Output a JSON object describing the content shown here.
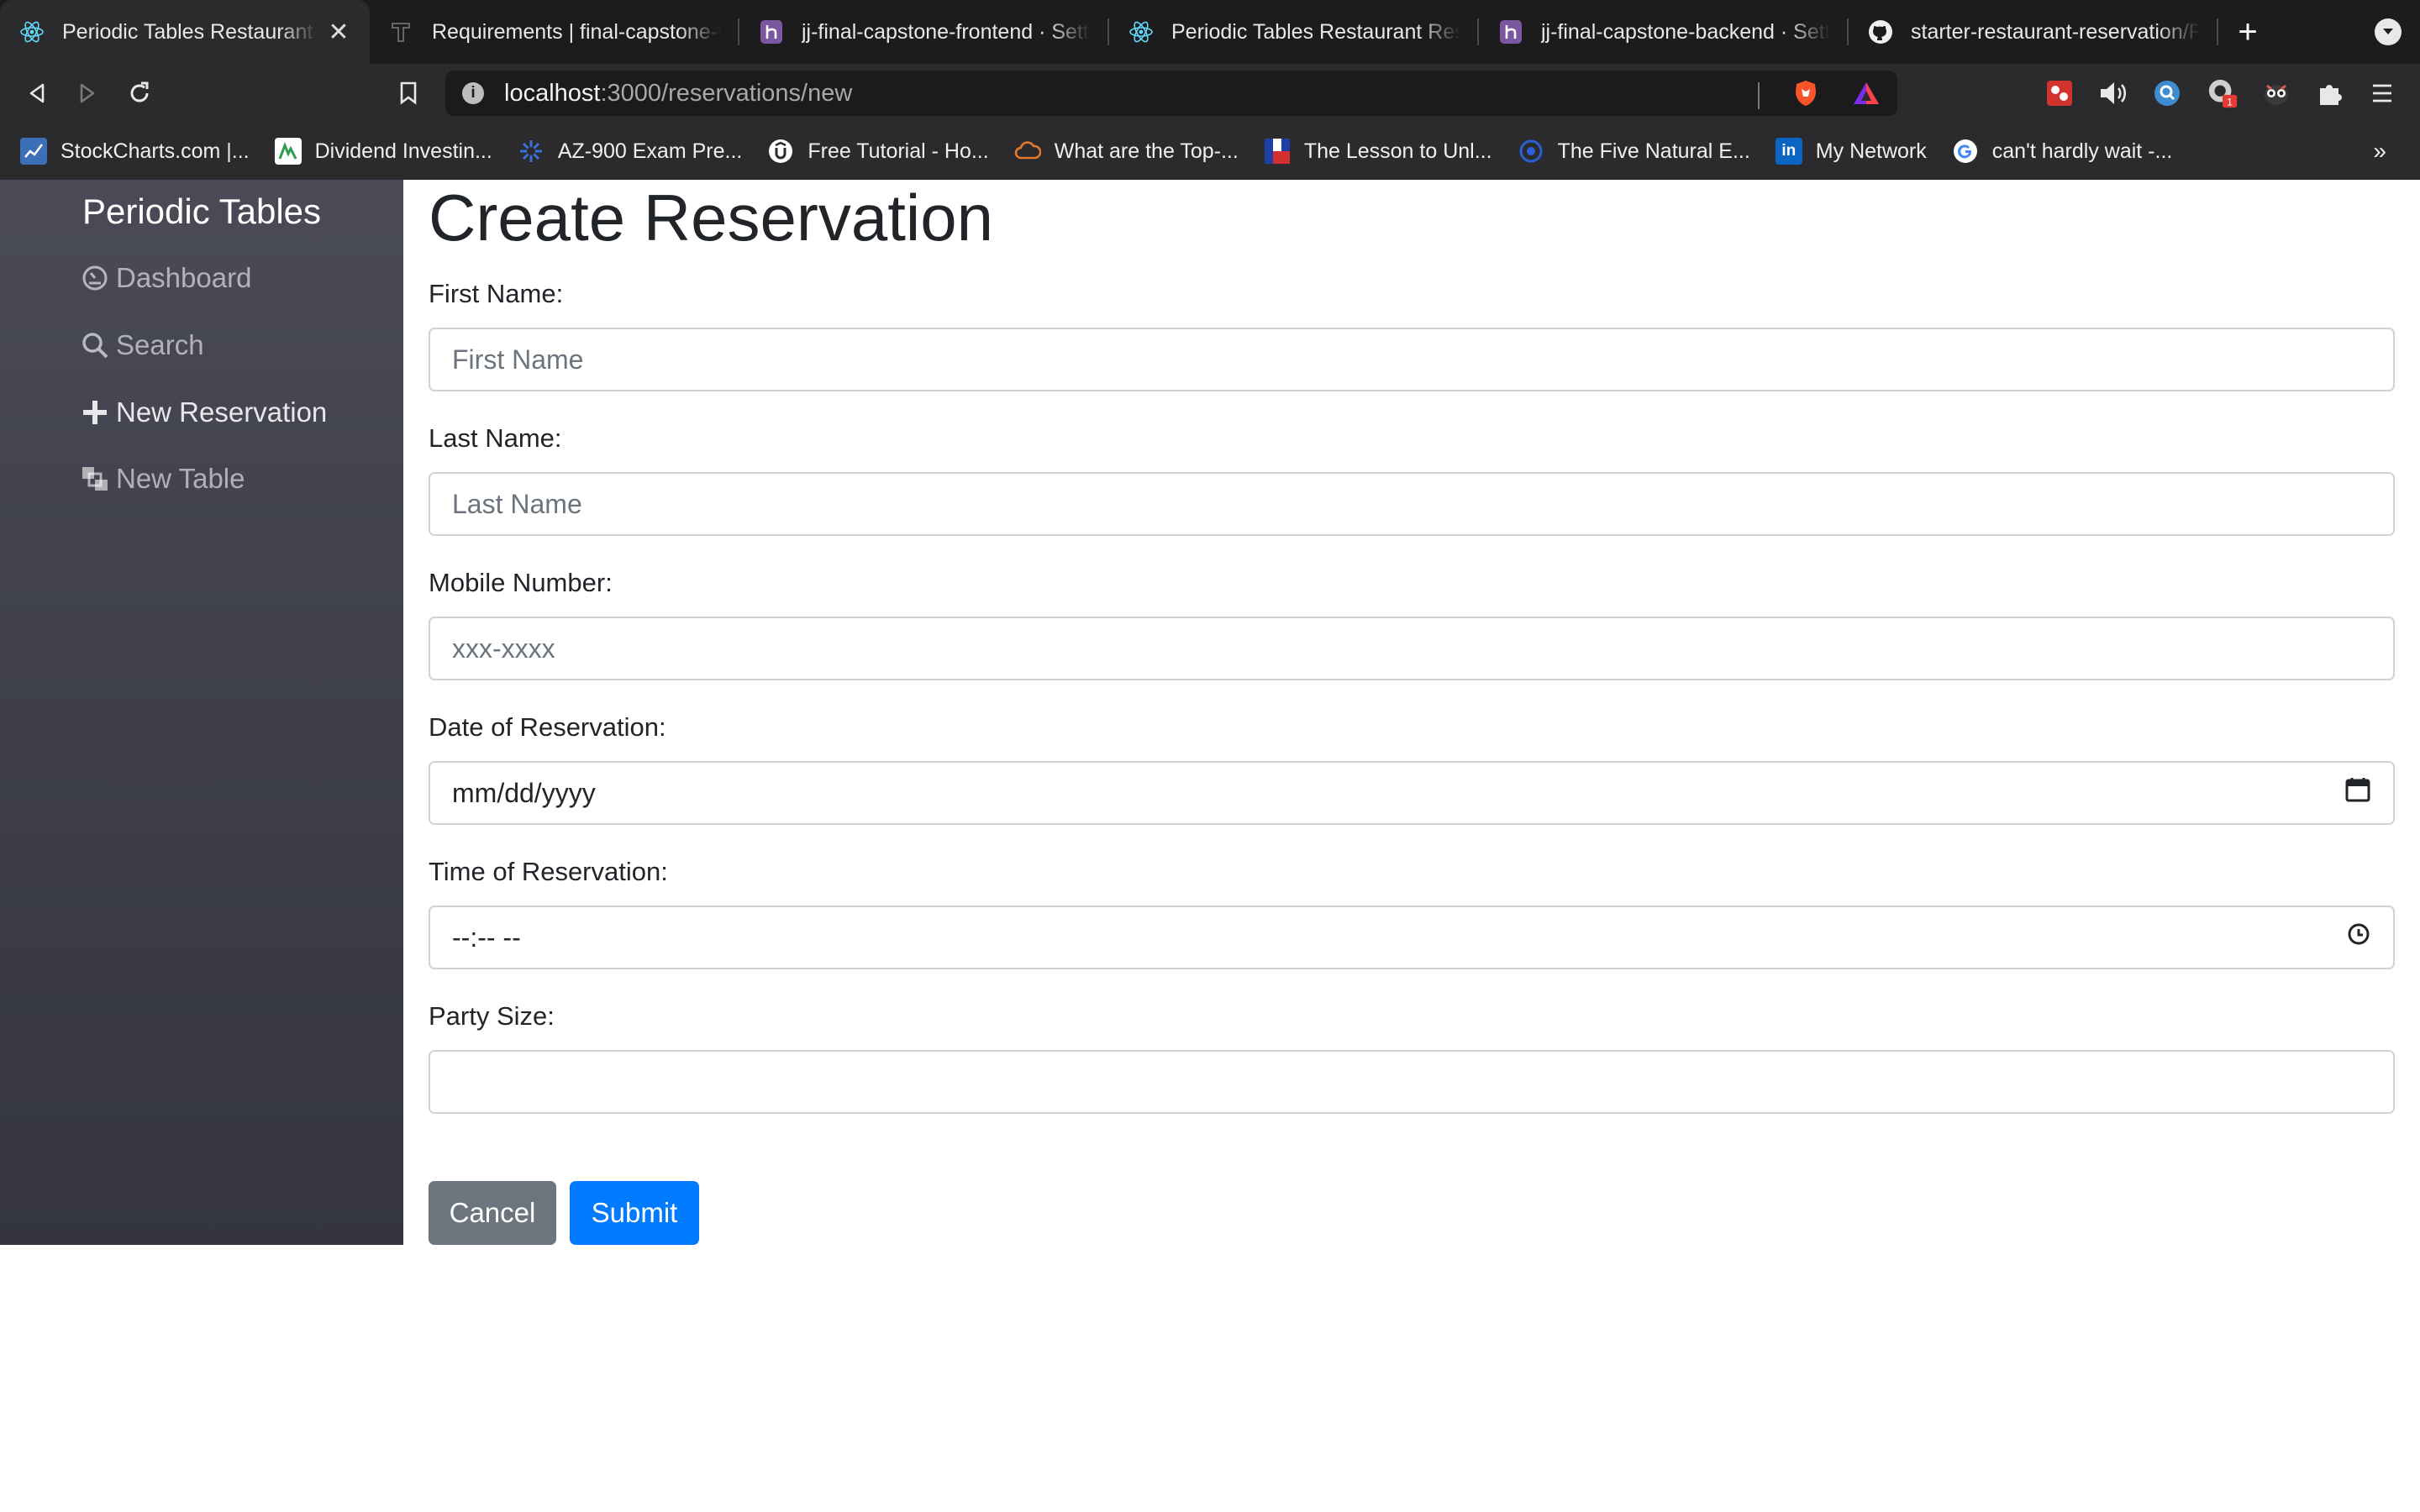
{
  "browser": {
    "tabs": [
      {
        "label": "Periodic Tables Restaurant Reservations",
        "icon": "react-icon",
        "active": true,
        "close": "✕"
      },
      {
        "label": "Requirements | final-capstone-v",
        "icon": "thinkful-icon",
        "active": false
      },
      {
        "label": "jj-final-capstone-frontend · Settings",
        "icon": "heroku-icon",
        "active": false
      },
      {
        "label": "Periodic Tables Restaurant Reservations",
        "icon": "react-icon",
        "active": false
      },
      {
        "label": "jj-final-capstone-backend · Settings",
        "icon": "heroku-icon",
        "active": false
      },
      {
        "label": "starter-restaurant-reservation/R",
        "icon": "github-icon",
        "active": false
      }
    ],
    "new_tab": "+",
    "url_host": "localhost",
    "url_path": ":3000/reservations/new",
    "bookmarks": [
      {
        "label": "StockCharts.com |...",
        "icon": "stockcharts-icon",
        "color": "#3b6fb6"
      },
      {
        "label": "Dividend Investin...",
        "icon": "dividend-icon",
        "color": "#2e9d4f"
      },
      {
        "label": "AZ-900 Exam Pre...",
        "icon": "az900-icon",
        "color": "#3a6fd8"
      },
      {
        "label": "Free Tutorial - Ho...",
        "icon": "udemy-icon",
        "color": "#ffffff"
      },
      {
        "label": "What are the Top-...",
        "icon": "cloud-icon",
        "color": "#e07a2a"
      },
      {
        "label": "The Lesson to Unl...",
        "icon": "flag-icon",
        "color": "#1d3fa6"
      },
      {
        "label": "The Five Natural E...",
        "icon": "circle-icon",
        "color": "#2a5fd8"
      },
      {
        "label": "My Network",
        "icon": "linkedin-icon",
        "color": "#0a66c2"
      },
      {
        "label": "can't hardly wait -...",
        "icon": "google-icon",
        "color": "#ffffff"
      }
    ],
    "bookmarks_more": "»"
  },
  "sidebar": {
    "brand": "Periodic Tables",
    "items": [
      {
        "label": "Dashboard",
        "icon": "dashboard-icon"
      },
      {
        "label": "Search",
        "icon": "search-icon"
      },
      {
        "label": "New Reservation",
        "icon": "plus-icon"
      },
      {
        "label": "New Table",
        "icon": "table-icon"
      }
    ]
  },
  "form": {
    "title": "Create Reservation",
    "first_name": {
      "label": "First Name:",
      "placeholder": "First Name"
    },
    "last_name": {
      "label": "Last Name:",
      "placeholder": "Last Name"
    },
    "mobile": {
      "label": "Mobile Number:",
      "placeholder": "xxx-xxxx"
    },
    "date": {
      "label": "Date of Reservation:",
      "placeholder": "mm/dd/yyyy"
    },
    "time": {
      "label": "Time of Reservation:",
      "placeholder": "--:-- --"
    },
    "party": {
      "label": "Party Size:",
      "placeholder": ""
    },
    "cancel": "Cancel",
    "submit": "Submit"
  },
  "colors": {
    "sidebar": "#3e3f4a",
    "primary": "#007bff",
    "secondary": "#6c757d"
  }
}
